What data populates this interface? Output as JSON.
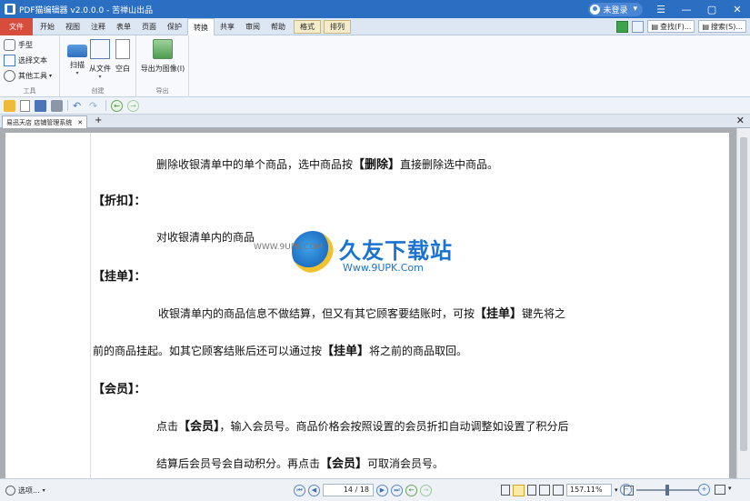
{
  "app": {
    "title": "PDF猫编辑器 v2.0.0.0 - 苦禅山出品",
    "login": "未登录"
  },
  "menu": {
    "tabs": [
      "文件",
      "开始",
      "视图",
      "注释",
      "表单",
      "页面",
      "保护",
      "转换",
      "共享",
      "审阅",
      "帮助",
      "格式",
      "排列"
    ],
    "active": "转换",
    "find": "查找(F)...",
    "search": "搜索(S)..."
  },
  "ribbon": {
    "tools": {
      "items": [
        "手型",
        "选择文本",
        "其他工具"
      ],
      "label": "工具"
    },
    "create": {
      "items": [
        "扫描",
        "从文件",
        "空白"
      ],
      "label": "创建"
    },
    "export": {
      "items": [
        "导出为图像(I)"
      ],
      "label": "导出"
    }
  },
  "doc_tab": {
    "name": "易迅天店 店铺管理系统"
  },
  "page_text": {
    "l1": "删除收银清单中的单个商品，选中商品按",
    "l1_key": "【删除】",
    "l1_end": "直接删除选中商品。",
    "h_discount": "【折扣】：",
    "l2": "对收银清单内的商品",
    "h_hang": "【挂单】：",
    "l3": "收银清单内的商品信息不做结算，但又有其它顾客要结账时，可按",
    "l3_key": "【挂单】",
    "l3_end": "键先将之",
    "l4": "前的商品挂起。如其它顾客结账后还可以通过按",
    "l4_key": "【挂单】",
    "l4_end": "将之前的商品取回。",
    "h_member": "【会员】：",
    "l5": "点击",
    "l5_key": "【会员】",
    "l5_end": "，输入会员号。商品价格会按照设置的会员折扣自动调整如设置了积分后",
    "l6": "结算后会员号会自动积分。再点击",
    "l6_key": "【会员】",
    "l6_end": "可取消会员号。"
  },
  "watermark": {
    "brand": "久友下载站",
    "url": "Www.9UPK.Com",
    "small": "WWW.9UPK.COM"
  },
  "status": {
    "options": "选项...",
    "page_current": "14",
    "page_total": "18",
    "zoom": "157.11%"
  }
}
